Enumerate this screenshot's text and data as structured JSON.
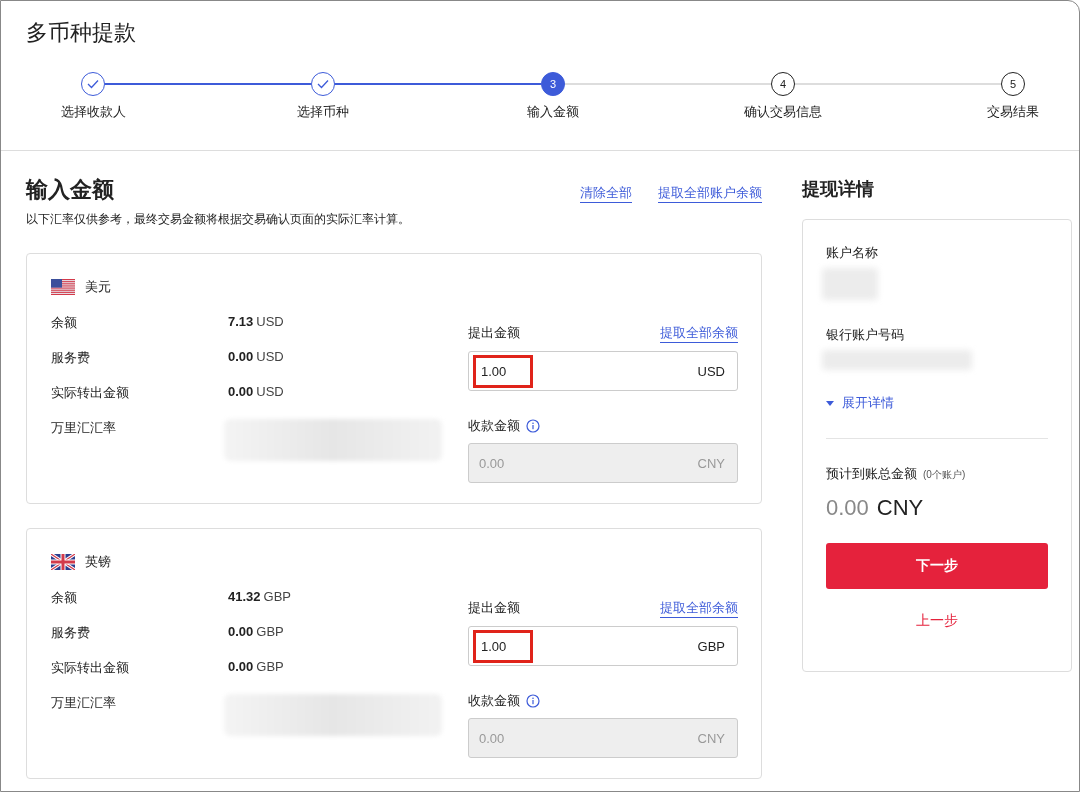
{
  "page_title": "多币种提款",
  "steps": [
    {
      "label": "选择收款人",
      "kind": "done"
    },
    {
      "label": "选择币种",
      "kind": "done"
    },
    {
      "number": "3",
      "label": "输入金额",
      "kind": "current"
    },
    {
      "number": "4",
      "label": "确认交易信息",
      "kind": "pending"
    },
    {
      "number": "5",
      "label": "交易结果",
      "kind": "pending"
    }
  ],
  "main": {
    "title": "输入金额",
    "note": "以下汇率仅供参考，最终交易金额将根据交易确认页面的实际汇率计算。",
    "links": [
      "清除全部",
      "提取全部账户余额"
    ],
    "currencies": [
      {
        "kind": "us",
        "name": "美元",
        "rows": [
          {
            "label": "余额",
            "amount": "7.13",
            "unit": "USD"
          },
          {
            "label": "服务费",
            "amount": "0.00",
            "unit": "USD"
          },
          {
            "label": "实际转出金额",
            "amount": "0.00",
            "unit": "USD"
          },
          {
            "label": "万里汇汇率"
          }
        ],
        "withdraw_label": "提出金额",
        "withdraw_all": "提取全部余额",
        "withdraw_value": "1.00",
        "withdraw_unit": "USD",
        "highlighted": true,
        "receive_label": "收款金额",
        "receive_placeholder": "0.00",
        "receive_unit": "CNY"
      },
      {
        "kind": "gb",
        "name": "英镑",
        "rows": [
          {
            "label": "余额",
            "amount": "41.32",
            "unit": "GBP"
          },
          {
            "label": "服务费",
            "amount": "0.00",
            "unit": "GBP"
          },
          {
            "label": "实际转出金额",
            "amount": "0.00",
            "unit": "GBP"
          },
          {
            "label": "万里汇汇率"
          }
        ],
        "withdraw_label": "提出金额",
        "withdraw_all": "提取全部余额",
        "withdraw_value": "1.00",
        "withdraw_unit": "GBP",
        "highlighted": true,
        "receive_label": "收款金额",
        "receive_placeholder": "0.00",
        "receive_unit": "CNY"
      }
    ]
  },
  "summary": {
    "title": "提现详情",
    "account_name_label": "账户名称",
    "bank_account_label": "银行账户号码",
    "expand_link": "展开详情",
    "total_label": "预计到账总金额",
    "total_count": "(0个账户)",
    "total_amount": "0.00",
    "total_unit": "CNY",
    "next_button": "下一步",
    "back_button": "上一步"
  }
}
